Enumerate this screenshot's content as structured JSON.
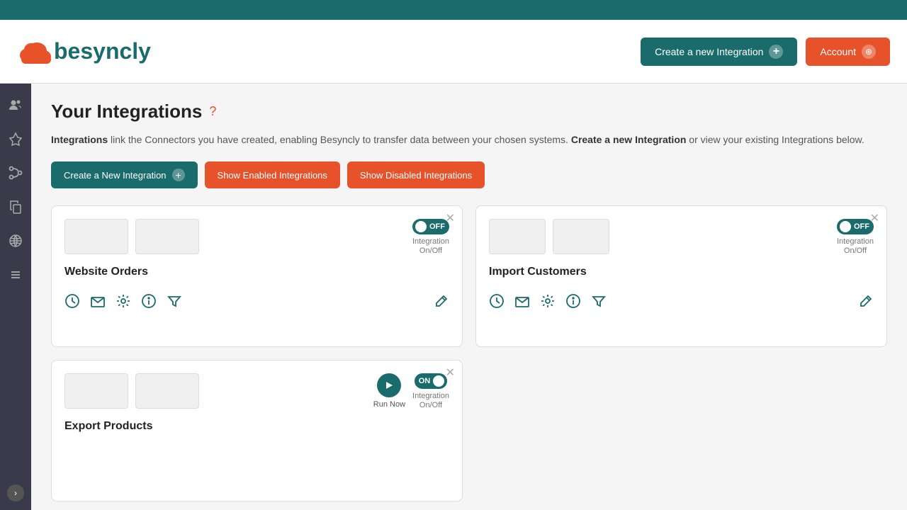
{
  "topBar": {},
  "header": {
    "logo": "besyncly",
    "createIntegrationBtn": "Create a new Integration",
    "accountBtn": "Account"
  },
  "sidebar": {
    "icons": [
      "people",
      "pin",
      "flow",
      "copy",
      "globe",
      "list"
    ],
    "expandLabel": ">"
  },
  "content": {
    "pageTitle": "Your Integrations",
    "helpIcon": "?",
    "description1": "Integrations",
    "description2": " link the Connectors you have created, enabling Besyncly to transfer data between your chosen systems. ",
    "description3": "Create a new Integration",
    "description4": " or view your existing Integrations below.",
    "buttons": {
      "createNew": "Create a New Integration",
      "showEnabled": "Show Enabled Integrations",
      "showDisabled": "Show Disabled Integrations"
    },
    "cards": [
      {
        "id": "card-website-orders",
        "title": "Website Orders",
        "toggleState": "OFF",
        "toggleLabel": "Integration\nOn/Off",
        "enabled": false
      },
      {
        "id": "card-import-customers",
        "title": "Import Customers",
        "toggleState": "OFF",
        "toggleLabel": "Integration\nOn/Off",
        "enabled": false
      },
      {
        "id": "card-export-products",
        "title": "Export Products",
        "toggleState": "ON",
        "toggleLabel": "Integration\nOn/Off",
        "enabled": true,
        "showRunNow": true
      }
    ],
    "iconLabels": {
      "clock": "clock-icon",
      "email": "email-icon",
      "settings": "settings-icon",
      "info": "info-icon",
      "filter": "filter-icon",
      "edit": "edit-icon"
    },
    "runNow": "Run Now"
  }
}
